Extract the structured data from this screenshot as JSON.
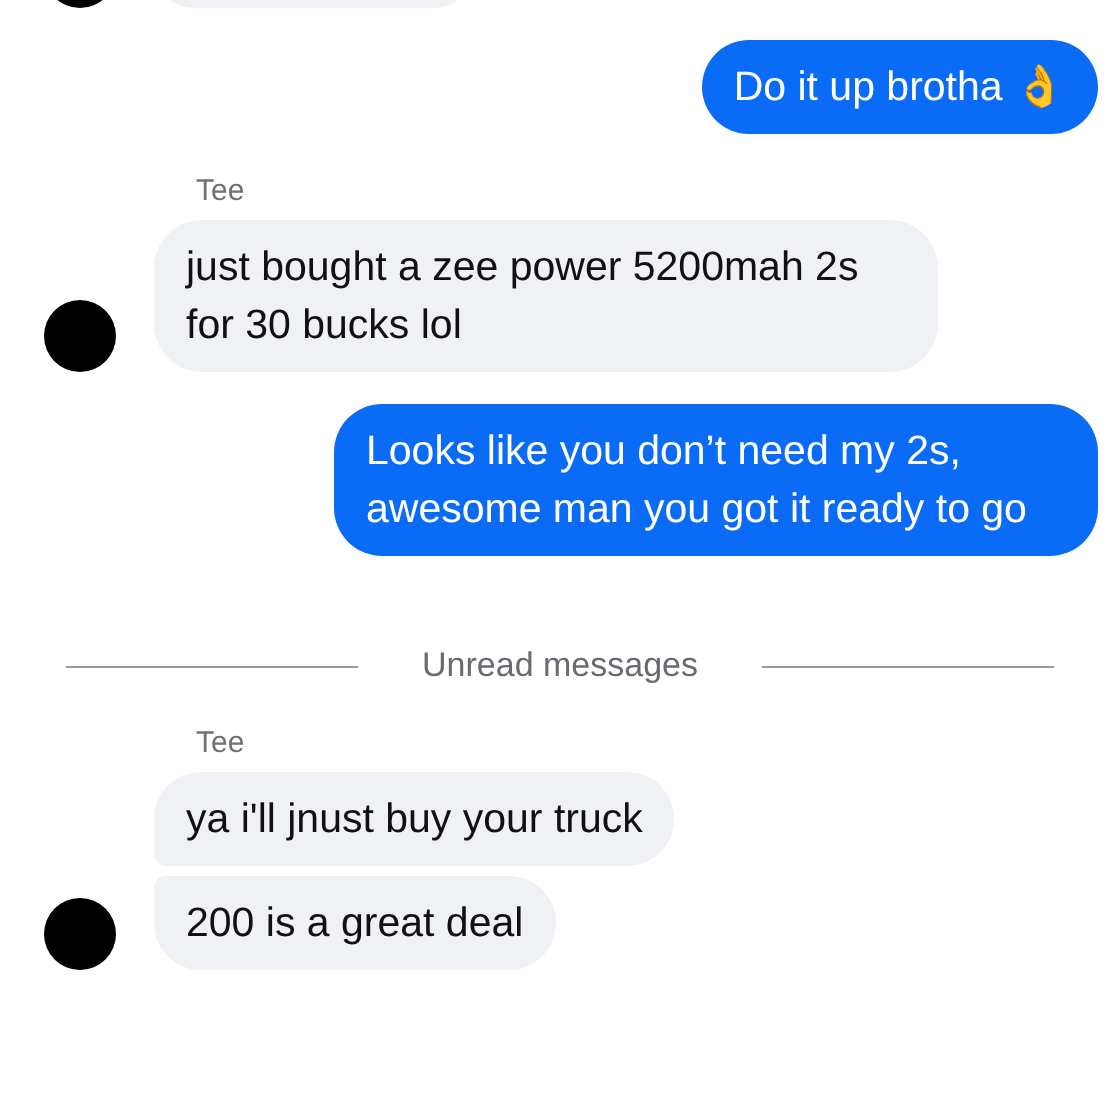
{
  "messages": [
    {
      "kind": "outgoing",
      "bubbles": [
        "Do it up brotha 👌"
      ]
    },
    {
      "kind": "incoming",
      "sender": "Tee",
      "bubbles": [
        "just bought a zee power 5200mah 2s for 30 bucks lol"
      ]
    },
    {
      "kind": "outgoing",
      "bubbles": [
        "Looks like you don’t need my 2s, awesome man you got it ready to go"
      ]
    },
    {
      "kind": "divider",
      "label": "Unread messages"
    },
    {
      "kind": "incoming",
      "sender": "Tee",
      "bubbles": [
        "ya i'll jnust buy your truck",
        "200 is a great deal"
      ]
    }
  ]
}
